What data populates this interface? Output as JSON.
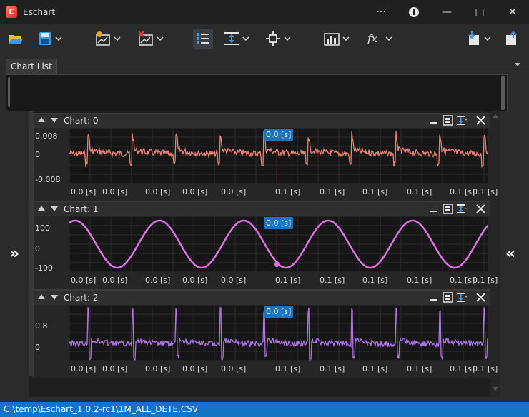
{
  "window": {
    "title": "Eschart",
    "logo_letter": "C",
    "more": "···",
    "info": "i",
    "minimize": "—",
    "maximize": "□",
    "close": "✕"
  },
  "toolbar": {
    "items": [
      {
        "icon": "open-folder-icon",
        "color": "#3a9ae8",
        "has_menu": false
      },
      {
        "icon": "save-icon",
        "color": "#3a9ae8",
        "has_menu": true
      },
      {
        "icon": "add-chart-icon",
        "color": "#f0a020",
        "has_menu": true
      },
      {
        "icon": "remove-chart-icon",
        "color": "#e03a3a",
        "has_menu": true
      },
      {
        "icon": "list-view-icon",
        "color": "#3a9ae8",
        "has_menu": false
      },
      {
        "icon": "fit-height-icon",
        "color": "#3a9ae8",
        "has_menu": true
      },
      {
        "icon": "crosshair-icon",
        "color": "#e6e6e6",
        "has_menu": true
      },
      {
        "icon": "statistics-icon",
        "color": "#e6e6e6",
        "has_menu": true
      },
      {
        "icon": "function-icon",
        "color": "#e6e6e6",
        "has_menu": true
      },
      {
        "icon": "export-icon",
        "color": "#3a9ae8",
        "has_menu": true
      },
      {
        "icon": "share-icon",
        "color": "#3a9ae8",
        "has_menu": false
      }
    ]
  },
  "tabs": {
    "chart_list": "Chart List"
  },
  "charts": [
    {
      "title": "Chart: 0",
      "color": "#f28070",
      "yticks": [
        "0.008",
        "0",
        "-0.008"
      ],
      "xticks": [
        "0.0 [s]",
        "0.0 [s]",
        "0.0 [s]",
        "0.0 [s]",
        "0.0 [s]",
        "0.1 [s]",
        "0.1 [s]",
        "0.1 [s]",
        "0.1 [s]",
        "0.1 [s]",
        "0.1 [s]"
      ],
      "cursor": "0.0 [s]",
      "kind": "spikes"
    },
    {
      "title": "Chart: 1",
      "color": "#e070e8",
      "yticks": [
        "100",
        "0",
        "-100"
      ],
      "xticks": [
        "0.0 [s]",
        "0.0 [s]",
        "0.0 [s]",
        "0.0 [s]",
        "0.0 [s]",
        "0.1 [s]",
        "0.1 [s]",
        "0.1 [s]",
        "0.1 [s]",
        "0.1 [s]",
        "0.1 [s]"
      ],
      "cursor": "0.0 [s]",
      "kind": "sine"
    },
    {
      "title": "Chart: 2",
      "color": "#b070e8",
      "yticks": [
        "0.8",
        "0"
      ],
      "xticks": [
        "0.0 [s]",
        "0.0 [s]",
        "0.0 [s]",
        "0.0 [s]",
        "0.0 [s]",
        "0.1 [s]",
        "0.1 [s]",
        "0.1 [s]",
        "0.1 [s]",
        "0.1 [s]",
        "0.1 [s]"
      ],
      "cursor": "0.0 [s]",
      "kind": "spikes2"
    }
  ],
  "nav": {
    "expand_left": "»",
    "expand_right": "«"
  },
  "status": {
    "path": "C:\\temp\\Eschart_1.0.2-rc1\\1M_ALL_DETE.CSV"
  }
}
